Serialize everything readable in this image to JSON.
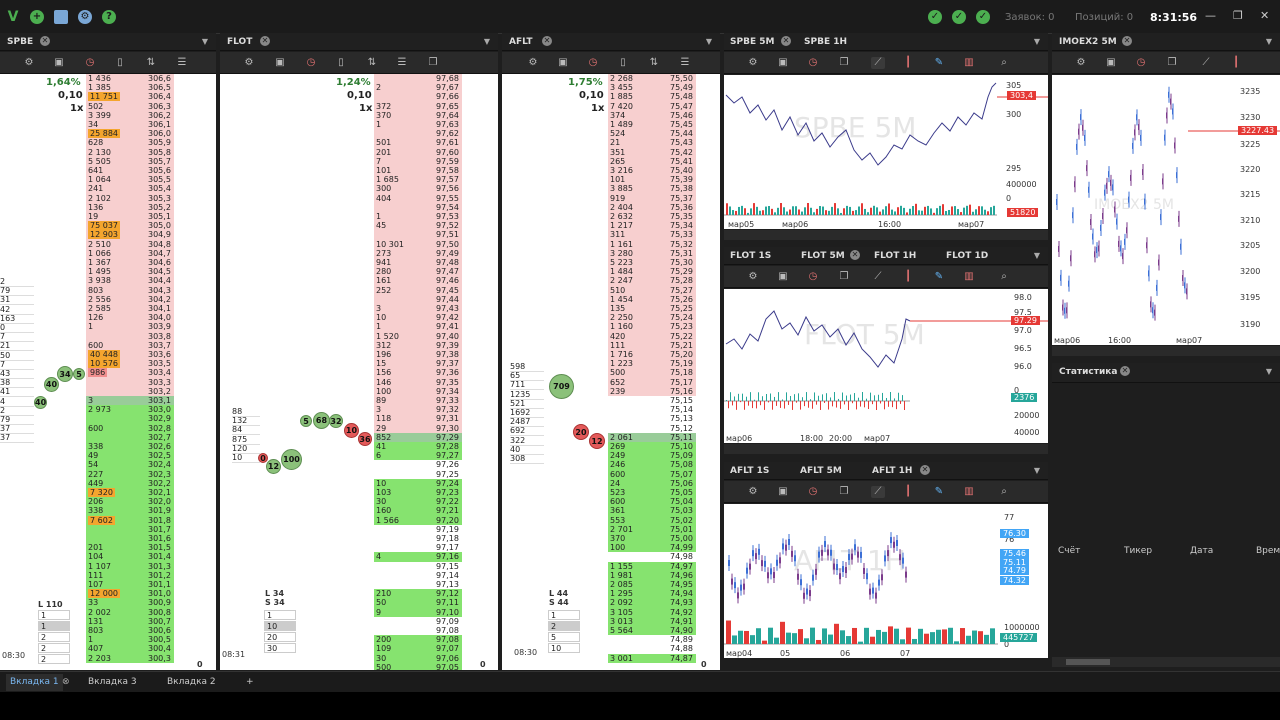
{
  "topbar": {
    "orders_label": "Заявок: 0",
    "positions_label": "Позиций: 0",
    "clock": "8:31:56"
  },
  "panels": {
    "spbe": {
      "tab": "SPBE",
      "pct": "1,64%",
      "step": "0,10",
      "mult": "1x",
      "time": "08:30",
      "bottom_zero": "0",
      "rows": [
        [
          "1 436",
          "306,6",
          "a"
        ],
        [
          "1 385",
          "306,5",
          "a"
        ],
        [
          "11 751",
          "306,4",
          "a"
        ],
        [
          "502",
          "306,3",
          "a"
        ],
        [
          "3 399",
          "306,2",
          "a"
        ],
        [
          "34",
          "306,1",
          "a"
        ],
        [
          "25 884",
          "306,0",
          "a"
        ],
        [
          "628",
          "305,9",
          "a"
        ],
        [
          "2 130",
          "305,8",
          "a"
        ],
        [
          "5 505",
          "305,7",
          "a"
        ],
        [
          "641",
          "305,6",
          "a"
        ],
        [
          "1 064",
          "305,5",
          "a"
        ],
        [
          "241",
          "305,4",
          "a"
        ],
        [
          "2 102",
          "305,3",
          "a"
        ],
        [
          "136",
          "305,2",
          "a"
        ],
        [
          "19",
          "305,1",
          "a"
        ],
        [
          "75 037",
          "305,0",
          "a"
        ],
        [
          "12 903",
          "304,9",
          "a"
        ],
        [
          "2 510",
          "304,8",
          "a"
        ],
        [
          "1 066",
          "304,7",
          "a"
        ],
        [
          "1 367",
          "304,6",
          "a"
        ],
        [
          "1 495",
          "304,5",
          "a"
        ],
        [
          "3 938",
          "304,4",
          "a"
        ],
        [
          "803",
          "304,3",
          "a"
        ],
        [
          "2 556",
          "304,2",
          "a"
        ],
        [
          "2 585",
          "304,1",
          "a"
        ],
        [
          "126",
          "304,0",
          "a"
        ],
        [
          "1",
          "303,9",
          "a"
        ],
        [
          "",
          "303,8",
          "a"
        ],
        [
          "600",
          "303,7",
          "a"
        ],
        [
          "40 448",
          "303,6",
          "a"
        ],
        [
          "10 576",
          "303,5",
          "a"
        ],
        [
          "986",
          "303,4",
          "a"
        ],
        [
          "",
          "303,3",
          "a"
        ],
        [
          "",
          "303,2",
          "a"
        ],
        [
          "3",
          "303,1",
          "m"
        ],
        [
          "2 973",
          "303,0",
          "b"
        ],
        [
          "",
          "302,9",
          "b"
        ],
        [
          "600",
          "302,8",
          "b"
        ],
        [
          "",
          "302,7",
          "b"
        ],
        [
          "338",
          "302,6",
          "b"
        ],
        [
          "49",
          "302,5",
          "b"
        ],
        [
          "54",
          "302,4",
          "b"
        ],
        [
          "227",
          "302,3",
          "b"
        ],
        [
          "449",
          "302,2",
          "b"
        ],
        [
          "7 320",
          "302,1",
          "b"
        ],
        [
          "206",
          "302,0",
          "b"
        ],
        [
          "338",
          "301,9",
          "b"
        ],
        [
          "7 602",
          "301,8",
          "b"
        ],
        [
          "",
          "301,7",
          "b"
        ],
        [
          "",
          "301,6",
          "b"
        ],
        [
          "201",
          "301,5",
          "b"
        ],
        [
          "104",
          "301,4",
          "b"
        ],
        [
          "1 107",
          "301,3",
          "b"
        ],
        [
          "111",
          "301,2",
          "b"
        ],
        [
          "107",
          "301,1",
          "b"
        ],
        [
          "12 000",
          "301,0",
          "b"
        ],
        [
          "33",
          "300,9",
          "b"
        ],
        [
          "2 002",
          "300,8",
          "b"
        ],
        [
          "131",
          "300,7",
          "b"
        ],
        [
          "803",
          "300,6",
          "b"
        ],
        [
          "1",
          "300,5",
          "b"
        ],
        [
          "407",
          "300,4",
          "b"
        ],
        [
          "2 203",
          "300,3",
          "b"
        ]
      ],
      "left": [
        "2",
        "79",
        "31",
        "42",
        "163",
        "0",
        "7",
        "21",
        "50",
        "7",
        "43",
        "38",
        "41",
        "4",
        "2",
        "79",
        "37",
        "37"
      ],
      "ls_l": "L 110",
      "ls_rows": [
        "1",
        "1",
        "2",
        "2",
        "2"
      ]
    },
    "flot": {
      "tab": "FLOT",
      "pct": "1,24%",
      "step": "0,10",
      "mult": "1x",
      "time": "08:31",
      "bottom_zero": "0",
      "rows": [
        [
          "",
          "97,68",
          "a"
        ],
        [
          "2",
          "97,67",
          "a"
        ],
        [
          "",
          "97,66",
          "a"
        ],
        [
          "372",
          "97,65",
          "a"
        ],
        [
          "370",
          "97,64",
          "a"
        ],
        [
          "1",
          "97,63",
          "a"
        ],
        [
          "",
          "97,62",
          "a"
        ],
        [
          "501",
          "97,61",
          "a"
        ],
        [
          "201",
          "97,60",
          "a"
        ],
        [
          "7",
          "97,59",
          "a"
        ],
        [
          "101",
          "97,58",
          "a"
        ],
        [
          "1 685",
          "97,57",
          "a"
        ],
        [
          "300",
          "97,56",
          "a"
        ],
        [
          "404",
          "97,55",
          "a"
        ],
        [
          "",
          "97,54",
          "a"
        ],
        [
          "1",
          "97,53",
          "a"
        ],
        [
          "45",
          "97,52",
          "a"
        ],
        [
          "",
          "97,51",
          "a"
        ],
        [
          "10 301",
          "97,50",
          "a"
        ],
        [
          "273",
          "97,49",
          "a"
        ],
        [
          "941",
          "97,48",
          "a"
        ],
        [
          "280",
          "97,47",
          "a"
        ],
        [
          "161",
          "97,46",
          "a"
        ],
        [
          "252",
          "97,45",
          "a"
        ],
        [
          "",
          "97,44",
          "a"
        ],
        [
          "3",
          "97,43",
          "a"
        ],
        [
          "10",
          "97,42",
          "a"
        ],
        [
          "1",
          "97,41",
          "a"
        ],
        [
          "1 520",
          "97,40",
          "a"
        ],
        [
          "312",
          "97,39",
          "a"
        ],
        [
          "196",
          "97,38",
          "a"
        ],
        [
          "15",
          "97,37",
          "a"
        ],
        [
          "156",
          "97,36",
          "a"
        ],
        [
          "146",
          "97,35",
          "a"
        ],
        [
          "100",
          "97,34",
          "a"
        ],
        [
          "89",
          "97,33",
          "a"
        ],
        [
          "3",
          "97,32",
          "a"
        ],
        [
          "118",
          "97,31",
          "a"
        ],
        [
          "29",
          "97,30",
          "a"
        ],
        [
          "852",
          "97,29",
          "m"
        ],
        [
          "41",
          "97,28",
          "b"
        ],
        [
          "6",
          "97,27",
          "b"
        ],
        [
          "",
          "97,26",
          "w"
        ],
        [
          "",
          "97,25",
          "w"
        ],
        [
          "10",
          "97,24",
          "b"
        ],
        [
          "103",
          "97,23",
          "b"
        ],
        [
          "30",
          "97,22",
          "b"
        ],
        [
          "160",
          "97,21",
          "b"
        ],
        [
          "1 566",
          "97,20",
          "b"
        ],
        [
          "",
          "97,19",
          "w"
        ],
        [
          "",
          "97,18",
          "w"
        ],
        [
          "",
          "97,17",
          "w"
        ],
        [
          "4",
          "97,16",
          "b"
        ],
        [
          "",
          "97,15",
          "w"
        ],
        [
          "",
          "97,14",
          "w"
        ],
        [
          "",
          "97,13",
          "w"
        ],
        [
          "210",
          "97,12",
          "b"
        ],
        [
          "50",
          "97,11",
          "b"
        ],
        [
          "9",
          "97,10",
          "b"
        ],
        [
          "",
          "97,09",
          "w"
        ],
        [
          "",
          "97,08",
          "w"
        ],
        [
          "200",
          "97,08",
          "b"
        ],
        [
          "109",
          "97,07",
          "b"
        ],
        [
          "30",
          "97,06",
          "b"
        ],
        [
          "500",
          "97,05",
          "b"
        ]
      ],
      "left": [
        "88",
        "132",
        "84",
        "875",
        "120",
        "10"
      ],
      "ls_l": "L 34",
      "ls_s": "S 34",
      "ls_rows": [
        "1",
        "10",
        "20",
        "30"
      ]
    },
    "aflt": {
      "tab": "AFLT",
      "pct": "1,75%",
      "step": "0,10",
      "mult": "1x",
      "time": "08:30",
      "bottom_zero": "0",
      "rows": [
        [
          "2 268",
          "75,50",
          "a"
        ],
        [
          "3 455",
          "75,49",
          "a"
        ],
        [
          "1 885",
          "75,48",
          "a"
        ],
        [
          "7 420",
          "75,47",
          "a"
        ],
        [
          "374",
          "75,46",
          "a"
        ],
        [
          "1 489",
          "75,45",
          "a"
        ],
        [
          "524",
          "75,44",
          "a"
        ],
        [
          "21",
          "75,43",
          "a"
        ],
        [
          "351",
          "75,42",
          "a"
        ],
        [
          "265",
          "75,41",
          "a"
        ],
        [
          "3 216",
          "75,40",
          "a"
        ],
        [
          "101",
          "75,39",
          "a"
        ],
        [
          "3 885",
          "75,38",
          "a"
        ],
        [
          "919",
          "75,37",
          "a"
        ],
        [
          "2 404",
          "75,36",
          "a"
        ],
        [
          "2 632",
          "75,35",
          "a"
        ],
        [
          "1 217",
          "75,34",
          "a"
        ],
        [
          "311",
          "75,33",
          "a"
        ],
        [
          "1 161",
          "75,32",
          "a"
        ],
        [
          "3 280",
          "75,31",
          "a"
        ],
        [
          "5 223",
          "75,30",
          "a"
        ],
        [
          "1 484",
          "75,29",
          "a"
        ],
        [
          "2 247",
          "75,28",
          "a"
        ],
        [
          "510",
          "75,27",
          "a"
        ],
        [
          "1 454",
          "75,26",
          "a"
        ],
        [
          "135",
          "75,25",
          "a"
        ],
        [
          "2 250",
          "75,24",
          "a"
        ],
        [
          "1 160",
          "75,23",
          "a"
        ],
        [
          "420",
          "75,22",
          "a"
        ],
        [
          "111",
          "75,21",
          "a"
        ],
        [
          "1 716",
          "75,20",
          "a"
        ],
        [
          "1 223",
          "75,19",
          "a"
        ],
        [
          "500",
          "75,18",
          "a"
        ],
        [
          "652",
          "75,17",
          "a"
        ],
        [
          "239",
          "75,16",
          "a"
        ],
        [
          "",
          "75,15",
          "w"
        ],
        [
          "",
          "75,14",
          "w"
        ],
        [
          "",
          "75,13",
          "w"
        ],
        [
          "",
          "75,12",
          "w"
        ],
        [
          "2 061",
          "75,11",
          "m"
        ],
        [
          "269",
          "75,10",
          "b"
        ],
        [
          "249",
          "75,09",
          "b"
        ],
        [
          "246",
          "75,08",
          "b"
        ],
        [
          "600",
          "75,07",
          "b"
        ],
        [
          "24",
          "75,06",
          "b"
        ],
        [
          "523",
          "75,05",
          "b"
        ],
        [
          "600",
          "75,04",
          "b"
        ],
        [
          "361",
          "75,03",
          "b"
        ],
        [
          "553",
          "75,02",
          "b"
        ],
        [
          "2 701",
          "75,01",
          "b"
        ],
        [
          "370",
          "75,00",
          "b"
        ],
        [
          "100",
          "74,99",
          "b"
        ],
        [
          "",
          "74,98",
          "w"
        ],
        [
          "1 155",
          "74,97",
          "b"
        ],
        [
          "1 981",
          "74,96",
          "b"
        ],
        [
          "2 085",
          "74,95",
          "b"
        ],
        [
          "1 295",
          "74,94",
          "b"
        ],
        [
          "2 092",
          "74,93",
          "b"
        ],
        [
          "3 105",
          "74,92",
          "b"
        ],
        [
          "3 013",
          "74,91",
          "b"
        ],
        [
          "5 564",
          "74,90",
          "b"
        ],
        [
          "",
          "74,89",
          "w"
        ],
        [
          "",
          "74,88",
          "w"
        ],
        [
          "3 001",
          "74,87",
          "b"
        ]
      ],
      "left": [
        "598",
        "65",
        "711",
        "1235",
        "521",
        "1692",
        "2487",
        "692",
        "322",
        "40",
        "308"
      ],
      "ls_l": "L 44",
      "ls_s": "S 44",
      "ls_rows": [
        "1",
        "2",
        "5",
        "10"
      ]
    }
  },
  "charts": {
    "spbe5m": {
      "tab1": "SPBE 5M",
      "tab2": "SPBE 1H",
      "watermark": "SPBE 5M",
      "price_tag": "303,4",
      "vol_tag": "51820",
      "y": [
        "305",
        "300",
        "295",
        "400000",
        "0"
      ],
      "x": [
        "мар05",
        "мар06",
        "16:00",
        "мар07"
      ]
    },
    "imoex": {
      "tab": "IMOEX2 5M",
      "watermark": "IMOEX2 5M",
      "price_tag": "3227.43",
      "y": [
        "3235",
        "3230",
        "3225",
        "3220",
        "3215",
        "3210",
        "3205",
        "3200",
        "3195",
        "3190"
      ],
      "x": [
        "мар06",
        "16:00",
        "мар07"
      ]
    },
    "flot": {
      "tabs": [
        "FLOT 1S",
        "FLOT 5M",
        "FLOT 1H",
        "FLOT 1D"
      ],
      "watermark": "FLOT 5M",
      "price_tag": "97.29",
      "vol_tag": "2376",
      "y": [
        "98.0",
        "97.5",
        "97.0",
        "96.5",
        "96.0",
        "0",
        "20000",
        "40000"
      ],
      "x": [
        "мар06",
        "18:00",
        "20:00",
        "мар07"
      ]
    },
    "aflt": {
      "tabs": [
        "AFLT 1S",
        "AFLT 5M",
        "AFLT 1H"
      ],
      "watermark": "AFLT 1H",
      "price_tags": [
        "76.30",
        "75.46",
        "75.11",
        "74.79",
        "74.32"
      ],
      "vol_tag": "445727",
      "y": [
        "77",
        "76",
        "0",
        "1000000"
      ],
      "x": [
        "мар04",
        "05",
        "06",
        "07"
      ]
    }
  },
  "stats": {
    "tab": "Статистика",
    "cols": [
      "Счёт",
      "Тикер",
      "Дата",
      "Врем"
    ]
  },
  "bottom": {
    "tabs": [
      "Вкладка 1",
      "Вкладка 3",
      "Вкладка 2"
    ],
    "plus": "+"
  },
  "colors": {
    "ask": "#f7cfcf",
    "bid": "#86e36f",
    "highlight": "#f4a52e",
    "accent": "#4caf50"
  }
}
